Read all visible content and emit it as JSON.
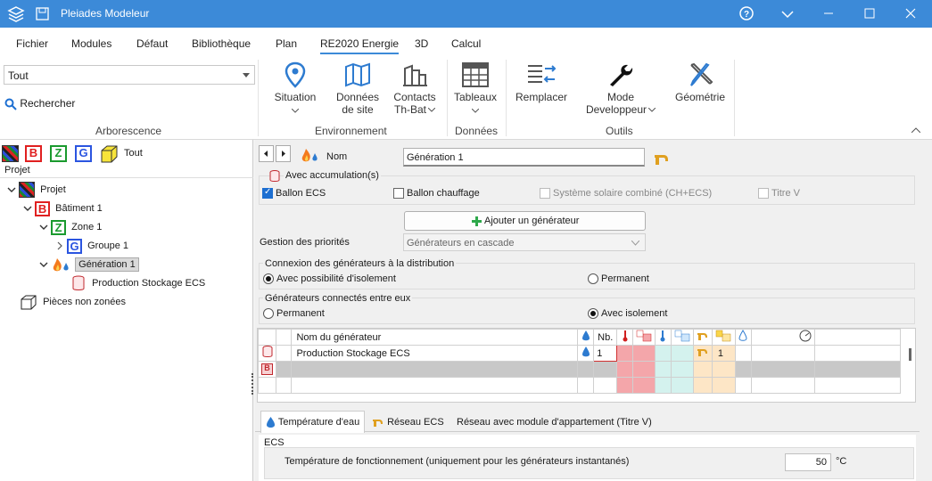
{
  "window": {
    "title": "Pleiades Modeleur"
  },
  "menu": {
    "items": [
      "Fichier",
      "Modules",
      "Défaut",
      "Bibliothèque",
      "Plan",
      "RE2020 Energie",
      "3D",
      "Calcul"
    ],
    "active": "RE2020 Energie"
  },
  "ribbon": {
    "filter_value": "Tout",
    "search_label": "Rechercher",
    "group_arborescence": "Arborescence",
    "situation": "Situation",
    "donnees_site_1": "Données",
    "donnees_site_2": "de site",
    "contacts_1": "Contacts",
    "contacts_2": "Th-Bat",
    "group_environnement": "Environnement",
    "tableaux": "Tableaux",
    "group_donnees": "Données",
    "remplacer": "Remplacer",
    "mode_1": "Mode",
    "mode_2": "Developpeur",
    "geometrie": "Géométrie",
    "group_outils": "Outils"
  },
  "tree": {
    "filter_letters": [
      "B",
      "Z",
      "G"
    ],
    "filter_all": "Tout",
    "header": "Projet",
    "projet": "Projet",
    "batiment": "Bâtiment 1",
    "zone": "Zone 1",
    "groupe": "Groupe 1",
    "generation": "Génération 1",
    "production": "Production Stockage ECS",
    "pieces": "Pièces non zonées"
  },
  "form": {
    "nom_label": "Nom",
    "nom_value": "Génération 1",
    "accumulation": "Avec accumulation(s)",
    "ballon_ecs": "Ballon ECS",
    "ballon_chauffage": "Ballon chauffage",
    "solaire": "Système solaire combiné (CH+ECS)",
    "titre_v": "Titre V",
    "ajouter": "Ajouter un générateur",
    "priorites_label": "Gestion des priorités",
    "priorites_value": "Générateurs en cascade",
    "connexion_title": "Connexion des générateurs à la distribution",
    "conn_isolement": "Avec possibilité d'isolement",
    "conn_permanent": "Permanent",
    "connectes_title": "Générateurs connectés entre eux",
    "gen_permanent": "Permanent",
    "gen_isolement": "Avec isolement"
  },
  "grid": {
    "col_nom": "Nom du générateur",
    "col_nb": "Nb.",
    "row1_name": "Production Stockage ECS",
    "row1_nb": "1",
    "row1_qty": "1"
  },
  "tabs": {
    "t1": "Température d'eau",
    "t2": "Réseau ECS",
    "t3": "Réseau avec module d'appartement (Titre V)"
  },
  "ecs": {
    "group": "ECS",
    "temp_label": "Température de fonctionnement (uniquement pour les générateurs instantanés)",
    "temp_value": "50",
    "temp_unit": "°C"
  },
  "colors": {
    "title_bar": "#3c8ad8",
    "accent": "#1d6fd1",
    "pink": "#f4a6aa",
    "cyan": "#d4f2ee",
    "peach": "#fde6c6"
  }
}
